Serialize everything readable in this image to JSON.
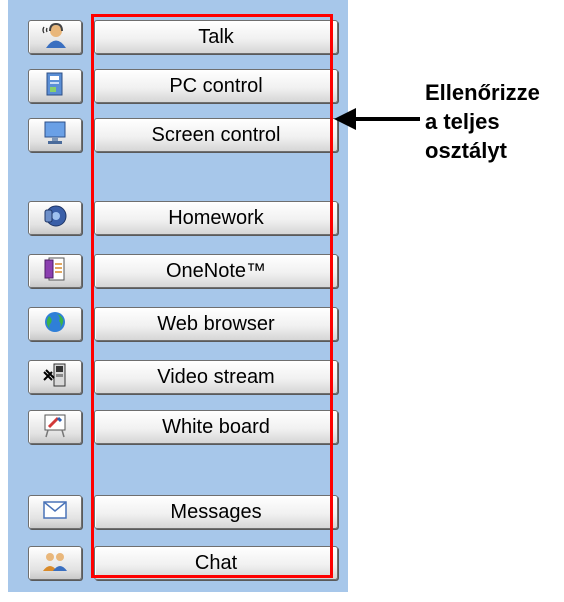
{
  "buttons": [
    {
      "label": "Talk",
      "icon": "talk-headset-icon"
    },
    {
      "label": "PC control",
      "icon": "pc-control-icon"
    },
    {
      "label": "Screen control",
      "icon": "screen-monitor-icon"
    },
    {
      "label": "Homework",
      "icon": "homework-disk-icon"
    },
    {
      "label": "OneNote™",
      "icon": "onenote-icon"
    },
    {
      "label": "Web browser",
      "icon": "globe-icon"
    },
    {
      "label": "Video stream",
      "icon": "video-stream-icon"
    },
    {
      "label": "White board",
      "icon": "whiteboard-icon"
    },
    {
      "label": "Messages",
      "icon": "envelope-icon"
    },
    {
      "label": "Chat",
      "icon": "chat-people-icon"
    }
  ],
  "callout": {
    "line1": "Ellenőrizze",
    "line2": "a teljes",
    "line3": "osztályt"
  },
  "colors": {
    "panel": "#a7c7ea",
    "highlight": "#ff0000",
    "arrow": "#000000"
  }
}
